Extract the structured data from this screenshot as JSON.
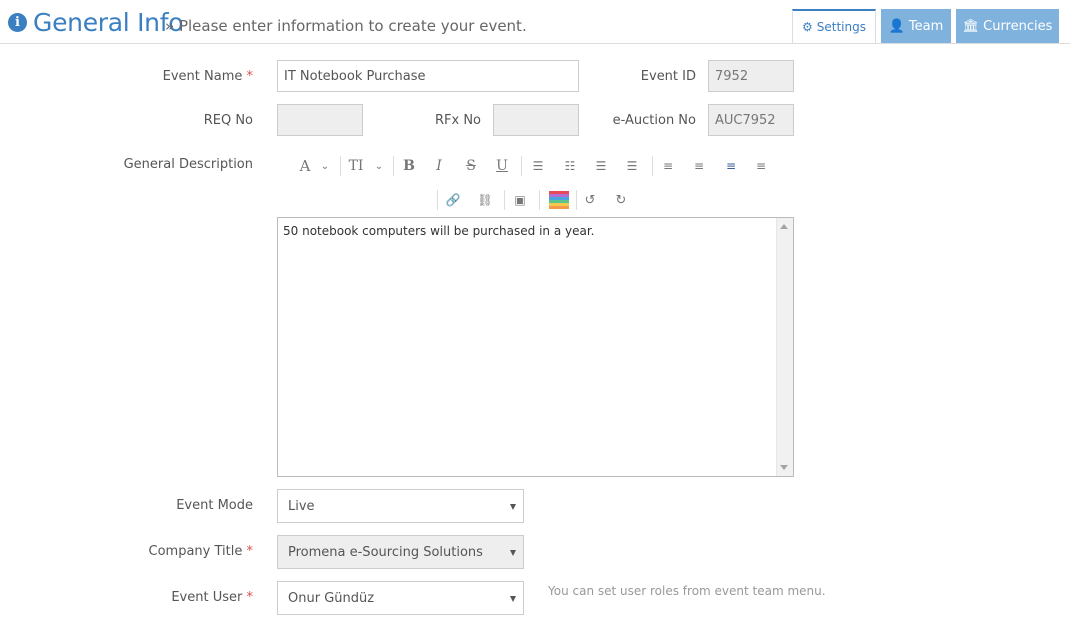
{
  "header": {
    "title": "General Info",
    "subtitle": "» Please enter information to create your event.",
    "info_icon": "info-circle-icon",
    "accent": "#3a7fc1"
  },
  "tabs": [
    {
      "label": "Settings",
      "icon": "gear-icon",
      "active": true
    },
    {
      "label": "Team",
      "icon": "user-icon",
      "active": false
    },
    {
      "label": "Currencies",
      "icon": "bank-icon",
      "active": false
    }
  ],
  "form": {
    "event_name": {
      "label": "Event Name",
      "required_mark": "*",
      "value": "IT Notebook Purchase"
    },
    "event_id": {
      "label": "Event ID",
      "value": "7952"
    },
    "req_no": {
      "label": "REQ No",
      "value": ""
    },
    "rfx_no": {
      "label": "RFx No",
      "value": ""
    },
    "eauction_no": {
      "label": "e-Auction No",
      "value": "AUC7952"
    },
    "general_description": {
      "label": "General Description",
      "value": "50 notebook computers will be purchased in a year."
    },
    "event_mode": {
      "label": "Event Mode",
      "value": "Live"
    },
    "company_title": {
      "label": "Company Title",
      "required_mark": "*",
      "value": "Promena e-Sourcing Solutions"
    },
    "event_user": {
      "label": "Event User",
      "required_mark": "*",
      "value": "Onur Gündüz"
    },
    "event_user_hint": "You can set user roles from event team menu."
  },
  "toolbar": {
    "row1": [
      "font-icon",
      "font-size-icon",
      "bold-icon",
      "italic-icon",
      "strikethrough-icon",
      "underline-icon",
      "unordered-list-icon",
      "ordered-list-icon",
      "outdent-icon",
      "indent-icon",
      "align-left-icon",
      "align-center-icon",
      "align-right-icon",
      "justify-icon"
    ],
    "row2": [
      "link-icon",
      "unlink-icon",
      "image-icon",
      "color-palette-icon",
      "undo-icon",
      "redo-icon"
    ]
  }
}
